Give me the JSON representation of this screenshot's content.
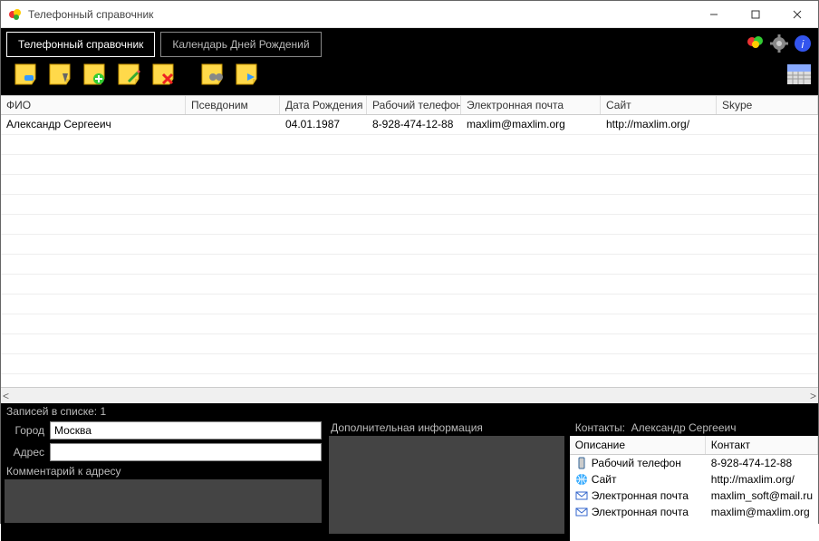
{
  "window": {
    "title": "Телефонный справочник"
  },
  "tabs": [
    {
      "label": "Телефонный справочник",
      "active": true
    },
    {
      "label": "Календарь Дней Рождений",
      "active": false
    }
  ],
  "grid": {
    "headers": [
      "ФИО",
      "Псевдоним",
      "Дата Рождения",
      "Рабочий телефон",
      "Электронная почта",
      "Сайт",
      "Skype"
    ],
    "rows": [
      {
        "fio": "Александр Сергееич",
        "alias": "",
        "dob": "04.01.1987",
        "workphone": "8-928-474-12-88",
        "email": "maxlim@maxlim.org",
        "site": "http://maxlim.org/",
        "skype": ""
      }
    ]
  },
  "status": {
    "records_label": "Записей в списке: 1"
  },
  "address": {
    "city_label": "Город",
    "city_value": "Москва",
    "addr_label": "Адрес",
    "addr_value": "",
    "comment_label": "Комментарий к адресу"
  },
  "extra": {
    "label": "Дополнительная информация"
  },
  "contacts": {
    "header_prefix": "Контакты:",
    "person": "Александр Сергееич",
    "col_desc": "Описание",
    "col_contact": "Контакт",
    "rows": [
      {
        "icon": "phone",
        "desc": "Рабочий телефон",
        "val": "8-928-474-12-88"
      },
      {
        "icon": "globe",
        "desc": "Сайт",
        "val": "http://maxlim.org/"
      },
      {
        "icon": "mail",
        "desc": "Электронная почта",
        "val": "maxlim_soft@mail.ru"
      },
      {
        "icon": "mail",
        "desc": "Электронная почта",
        "val": "maxlim@maxlim.org"
      }
    ]
  }
}
